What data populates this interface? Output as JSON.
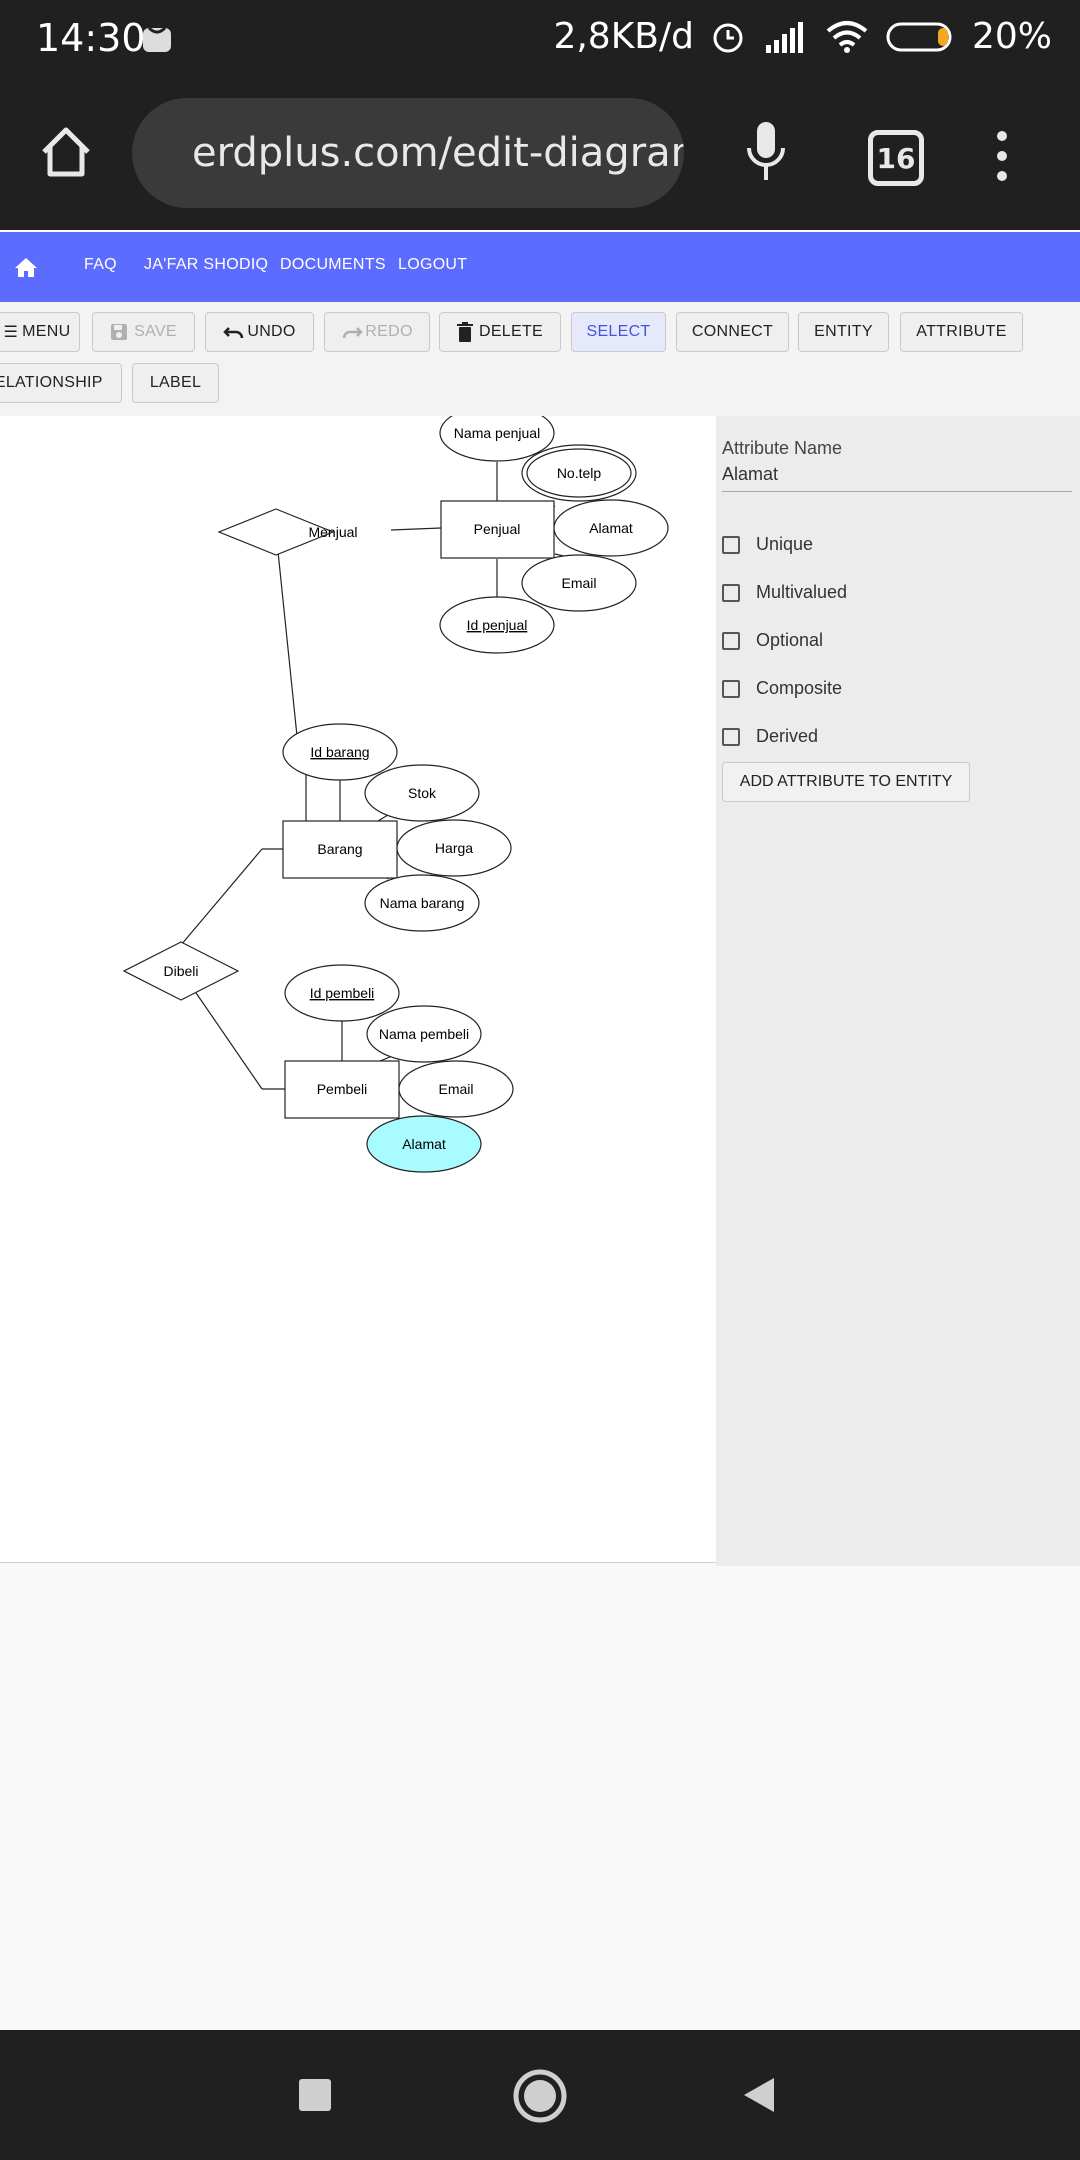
{
  "status": {
    "time": "14:30",
    "speed": "2,8KB/d",
    "battery": "20%"
  },
  "browser": {
    "url": "erdplus.com/edit-diagram",
    "tab_count": "16"
  },
  "nav": {
    "faq": "FAQ",
    "user": "JA'FAR SHODIQ",
    "documents": "DOCUMENTS",
    "logout": "LOGOUT"
  },
  "toolbar": {
    "menu": "MENU",
    "save": "SAVE",
    "undo": "UNDO",
    "redo": "REDO",
    "delete": "DELETE",
    "select": "SELECT",
    "connect": "CONNECT",
    "entity": "ENTITY",
    "attribute": "ATTRIBUTE",
    "relationship": "RELATIONSHIP",
    "label": "LABEL"
  },
  "panel": {
    "attr_label": "Attribute Name",
    "attr_value": "Alamat",
    "options": [
      "Unique",
      "Multivalued",
      "Optional",
      "Composite",
      "Derived"
    ],
    "add_button": "ADD ATTRIBUTE TO ENTITY"
  },
  "diagram": {
    "entities": [
      "Penjual",
      "Barang",
      "Pembeli"
    ],
    "relationships": [
      "Menjual",
      "Dibeli"
    ],
    "attributes": {
      "penjual": [
        "Nama penjual",
        "No.telp",
        "Alamat",
        "Email",
        "Id penjual"
      ],
      "barang": [
        "Id barang",
        "Stok",
        "Harga",
        "Nama barang"
      ],
      "pembeli": [
        "Id pembeli",
        "Nama pembeli",
        "Email",
        "Alamat"
      ]
    },
    "selected_color": "#a8fbff"
  },
  "colors": {
    "accent": "#5c6cff",
    "dark_bar": "#202020"
  }
}
